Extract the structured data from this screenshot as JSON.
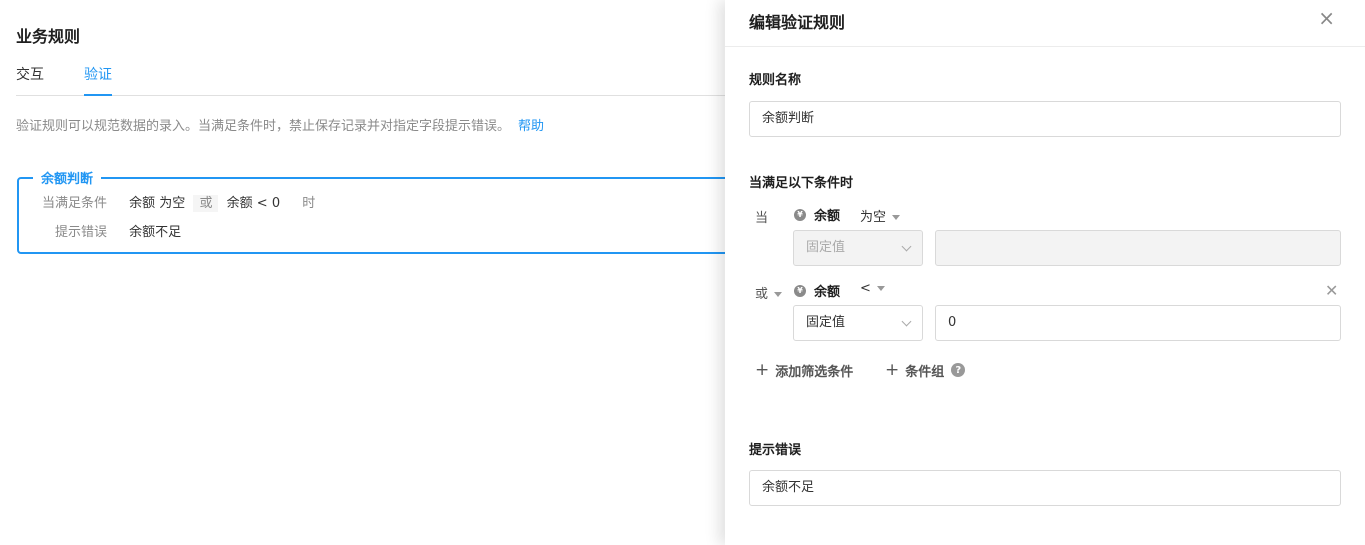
{
  "page": {
    "title": "业务规则",
    "tabs": [
      "交互",
      "验证"
    ],
    "description": "验证规则可以规范数据的录入。当满足条件时，禁止保存记录并对指定字段提示错误。",
    "help_link": "帮助"
  },
  "rule_card": {
    "name": "余额判断",
    "condition_label": "当满足条件",
    "condition1_field": "余额",
    "condition1_op": "为空",
    "or_label": "或",
    "condition2_field": "余额",
    "condition2_op": "<",
    "condition2_value": "0",
    "time_suffix": "时",
    "error_label": "提示错误",
    "error_text": "余额不足"
  },
  "drawer": {
    "title": "编辑验证规则",
    "close_icon": "×",
    "rule_name_label": "规则名称",
    "rule_name_value": "余额判断",
    "conditions_label": "当满足以下条件时",
    "conditions": [
      {
        "prefix": "当",
        "field": "余额",
        "operator": "为空",
        "value_type": "固定值",
        "value": "",
        "disabled": true
      },
      {
        "prefix": "或",
        "field": "余额",
        "operator": "<",
        "value_type": "固定值",
        "value": "0",
        "disabled": false
      }
    ],
    "add_condition": "添加筛选条件",
    "add_group": "条件组",
    "error_label": "提示错误",
    "error_value": "余额不足"
  },
  "icons": {
    "field_type_icon": "yen-icon",
    "help_icon": "question-circle-icon",
    "add_icon": "plus-icon",
    "remove_icon": "close-icon"
  },
  "colors": {
    "accent": "#2196f3",
    "muted_text": "#8a8a8a"
  }
}
